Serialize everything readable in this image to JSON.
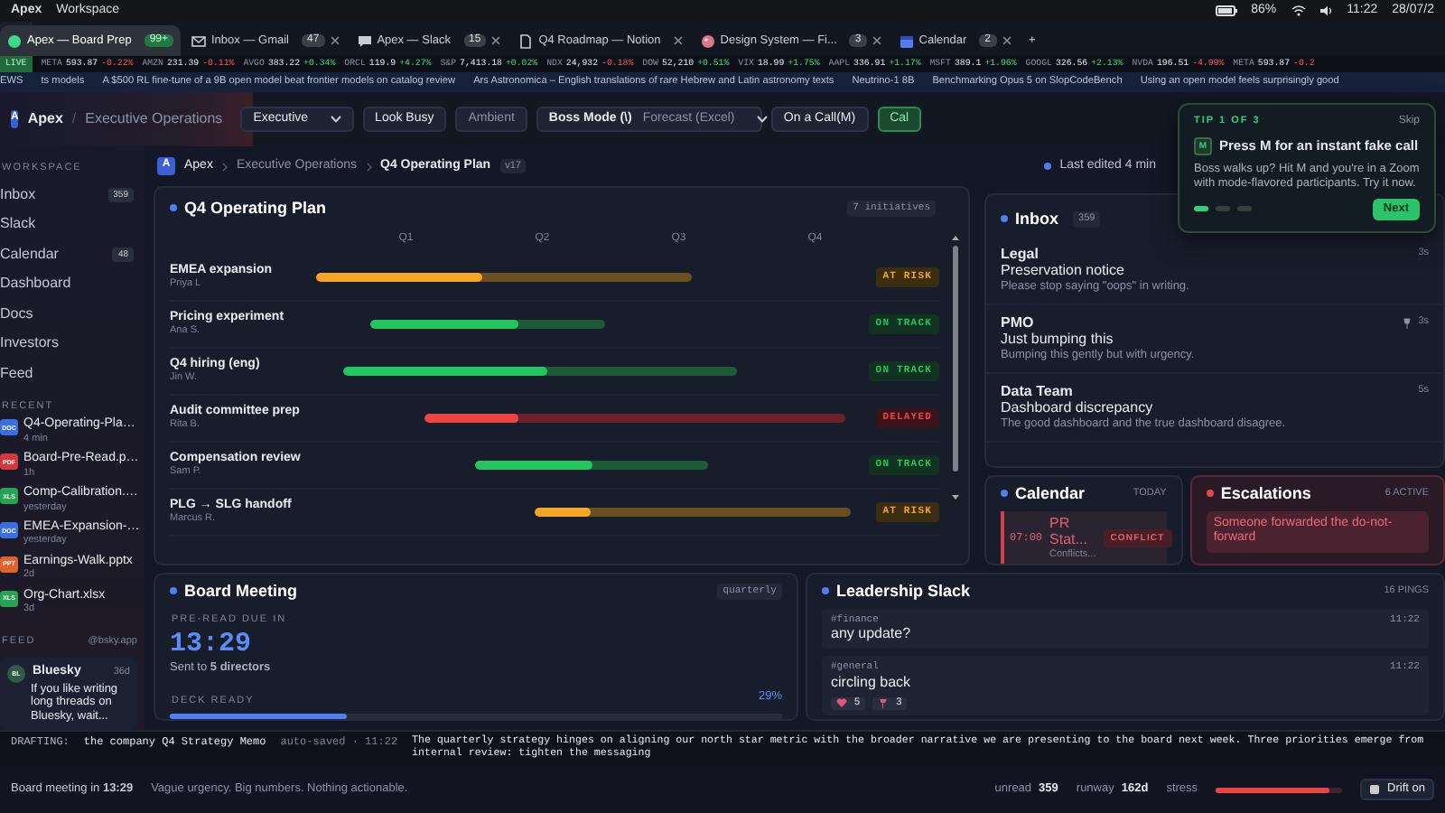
{
  "os_bar": {
    "app": "Apex",
    "menu": "Workspace",
    "battery": "86%",
    "time": "11:22",
    "date": "28/07/2"
  },
  "browser_tabs": [
    {
      "title": "Apex — Board Prep",
      "badge": "99+",
      "kind": "app",
      "selected": true
    },
    {
      "title": "Inbox — Gmail",
      "badge": "47",
      "kind": "mail",
      "selected": false
    },
    {
      "title": "Apex — Slack",
      "badge": "15",
      "kind": "chat",
      "selected": false
    },
    {
      "title": "Q4 Roadmap — Notion",
      "kind": "doc",
      "selected": false
    },
    {
      "title": "Design System — Fi...",
      "badge": "3",
      "kind": "design",
      "selected": false
    },
    {
      "title": "Calendar",
      "badge": "2",
      "kind": "calendar",
      "selected": false
    }
  ],
  "new_tab": "+",
  "ticker": {
    "label": "LIVE",
    "items": [
      {
        "symbol": "META",
        "price": "593.87",
        "change": "-0.22%",
        "rising": false
      },
      {
        "symbol": "AMZN",
        "price": "231.39",
        "change": "-0.11%",
        "rising": false
      },
      {
        "symbol": "AVGO",
        "price": "383.22",
        "change": "+0.34%",
        "rising": true
      },
      {
        "symbol": "ORCL",
        "price": "119.9",
        "change": "+4.27%",
        "rising": true
      },
      {
        "symbol": "S&P",
        "price": "7,413.18",
        "change": "+0.02%",
        "rising": true
      },
      {
        "symbol": "NDX",
        "price": "24,932",
        "change": "-0.18%",
        "rising": false
      },
      {
        "symbol": "DOW",
        "price": "52,210",
        "change": "+0.51%",
        "rising": true
      },
      {
        "symbol": "VIX",
        "price": "18.99",
        "change": "+1.75%",
        "rising": true
      },
      {
        "symbol": "AAPL",
        "price": "336.91",
        "change": "+1.17%",
        "rising": true
      },
      {
        "symbol": "MSFT",
        "price": "389.1",
        "change": "+1.96%",
        "rising": true
      },
      {
        "symbol": "GOOGL",
        "price": "326.56",
        "change": "+2.13%",
        "rising": true
      },
      {
        "symbol": "NVDA",
        "price": "196.51",
        "change": "-4.99%",
        "rising": false
      },
      {
        "symbol": "META",
        "price": "593.87",
        "change": "-0.2",
        "rising": false
      }
    ]
  },
  "news": {
    "label": "EWS",
    "items": [
      "ts models",
      "A $500 RL fine-tune of a 9B open model beat frontier models on catalog review",
      "Ars Astronomica – English translations of rare Hebrew and Latin astronomy texts",
      "Neutrino-1 8B",
      "Benchmarking Opus 5 on SlopCodeBench",
      "Using an open model feels surprisingly good"
    ]
  },
  "header": {
    "logo": "A",
    "workspace": "Apex",
    "separator": "/",
    "section": "Executive Operations",
    "view_select": "Executive",
    "buttons": [
      {
        "label": "Look Busy",
        "kind": "plain"
      },
      {
        "label": "Ambient",
        "kind": "muted"
      }
    ],
    "boss_mode": {
      "label": "Boss Mode (\\)",
      "value": "Forecast (Excel)"
    },
    "call_buttons": [
      {
        "label": "On a Call(M)",
        "kind": "plain"
      },
      {
        "label": "Cal",
        "kind": "green"
      }
    ]
  },
  "sidebar": {
    "workspace_heading": "WORKSPACE",
    "items": [
      {
        "label": "Inbox",
        "count": "359"
      },
      {
        "label": "Slack"
      },
      {
        "label": "Calendar",
        "count": "48"
      },
      {
        "label": "Dashboard"
      },
      {
        "label": "Docs"
      },
      {
        "label": "Investors"
      },
      {
        "label": "Feed"
      }
    ],
    "recent_heading": "RECENT",
    "recent": [
      {
        "type": "DOC",
        "name": "Q4-Operating-Pla…",
        "time": "4 min"
      },
      {
        "type": "PDF",
        "name": "Board-Pre-Read.p…",
        "time": "1h"
      },
      {
        "type": "XLS",
        "name": "Comp-Calibration.…",
        "time": "yesterday"
      },
      {
        "type": "DOC",
        "name": "EMEA-Expansion-…",
        "time": "yesterday"
      },
      {
        "type": "PPT",
        "name": "Earnings-Walk.pptx",
        "time": "2d"
      },
      {
        "type": "XLS",
        "name": "Org-Chart.xlsx",
        "time": "3d"
      }
    ],
    "feed": {
      "heading": "FEED",
      "source": "@bsky.app",
      "posts": [
        {
          "avatar": "BL",
          "author": "Bluesky",
          "age": "36d",
          "text": "If you like writing long threads on Bluesky, wait..."
        }
      ]
    }
  },
  "breadcrumb": {
    "logo": "A",
    "items": [
      "Apex",
      "Executive Operations",
      "Q4 Operating Plan"
    ],
    "version": "v17",
    "last_edited": "Last edited 4 min"
  },
  "plan": {
    "title": "Q4 Operating Plan",
    "count": "7 initiatives",
    "quarters": [
      "Q1",
      "Q2",
      "Q3",
      "Q4"
    ],
    "initiatives": [
      {
        "name": "EMEA expansion",
        "owner": "Priya L",
        "status": "AT RISK",
        "kind": "at_risk",
        "level": 0.44
      },
      {
        "name": "Pricing experiment",
        "owner": "Ana S.",
        "status": "ON TRACK",
        "kind": "on_track",
        "level": 0.63
      },
      {
        "name": "Q4 hiring (eng)",
        "owner": "Jin W.",
        "status": "ON TRACK",
        "kind": "on_track",
        "level": 0.52
      },
      {
        "name": "Audit committee prep",
        "owner": "Rita B.",
        "status": "DELAYED",
        "kind": "delayed",
        "level": 0.22
      },
      {
        "name": "Compensation review",
        "owner": "Sam P.",
        "status": "ON TRACK",
        "kind": "on_track",
        "level": 0.5
      },
      {
        "name": "PLG → SLG handoff",
        "owner": "Marcus R.",
        "status": "AT RISK",
        "kind": "at_risk",
        "level": 0.18
      }
    ]
  },
  "inbox": {
    "title": "Inbox",
    "count": "359",
    "messages": [
      {
        "sender": "Legal",
        "time": "3s",
        "subject": "Preservation notice",
        "preview": "Please stop saying \"oops\" in writing.",
        "pinned": false
      },
      {
        "sender": "PMO",
        "time": "3s",
        "subject": "Just bumping this",
        "preview": "Bumping this gently but with urgency.",
        "pinned": true
      },
      {
        "sender": "Data Team",
        "time": "5s",
        "subject": "Dashboard discrepancy",
        "preview": "The good dashboard and the true dashboard disagree.",
        "pinned": false
      }
    ]
  },
  "tip": {
    "step": "TIP 1 OF 3",
    "skip": "Skip",
    "key": "M",
    "title": "Press M for an instant fake call",
    "body": "Boss walks up? Hit M and you're in a Zoom with mode-flavored participants. Try it now.",
    "steps": [
      {
        "selected": true
      },
      {
        "selected": false
      },
      {
        "selected": false
      }
    ],
    "next": "Next"
  },
  "calendar": {
    "title": "Calendar",
    "label": "TODAY",
    "events": [
      {
        "time": "07:00",
        "title": "PR Stat...",
        "subtitle": "Conflicts...",
        "tag": "CONFLICT"
      }
    ]
  },
  "escalations": {
    "title": "Escalations",
    "count": "6 ACTIVE",
    "items": [
      "Someone forwarded the do-not-forward"
    ]
  },
  "board_meeting": {
    "title": "Board Meeting",
    "tag": "quarterly",
    "countdown_label": "PRE-READ DUE IN",
    "countdown": "13:29",
    "sent": "Sent to **5 directors**",
    "deck_label": "DECK READY",
    "deck_percent": "29%",
    "level": 0.29
  },
  "slack": {
    "title": "Leadership Slack",
    "count": "16 PINGS",
    "messages": [
      {
        "channel": "#finance",
        "time": "11:22",
        "text": "any update?"
      },
      {
        "channel": "#general",
        "time": "11:22",
        "text": "circling back",
        "reactions": [
          {
            "kind": "heart",
            "count": "5"
          },
          {
            "kind": "pin",
            "count": "3"
          }
        ]
      }
    ]
  },
  "drafting": {
    "label": "DRAFTING:",
    "document": "the company Q4 Strategy Memo",
    "saved": "auto-saved · 11:22",
    "text": "The quarterly strategy hinges on aligning our north star metric with the broader narrative we are presenting to the board next week. Three priorities emerge from internal review: tighten the messaging"
  },
  "status_bar": {
    "meeting": "Board meeting in **13:29**",
    "tagline": "Vague urgency. Big numbers. Nothing actionable.",
    "unread_label": "unread",
    "unread": "359",
    "runway_label": "runway",
    "runway": "162d",
    "stress_label": "stress",
    "level": 0.9,
    "drift": "Drift on"
  }
}
